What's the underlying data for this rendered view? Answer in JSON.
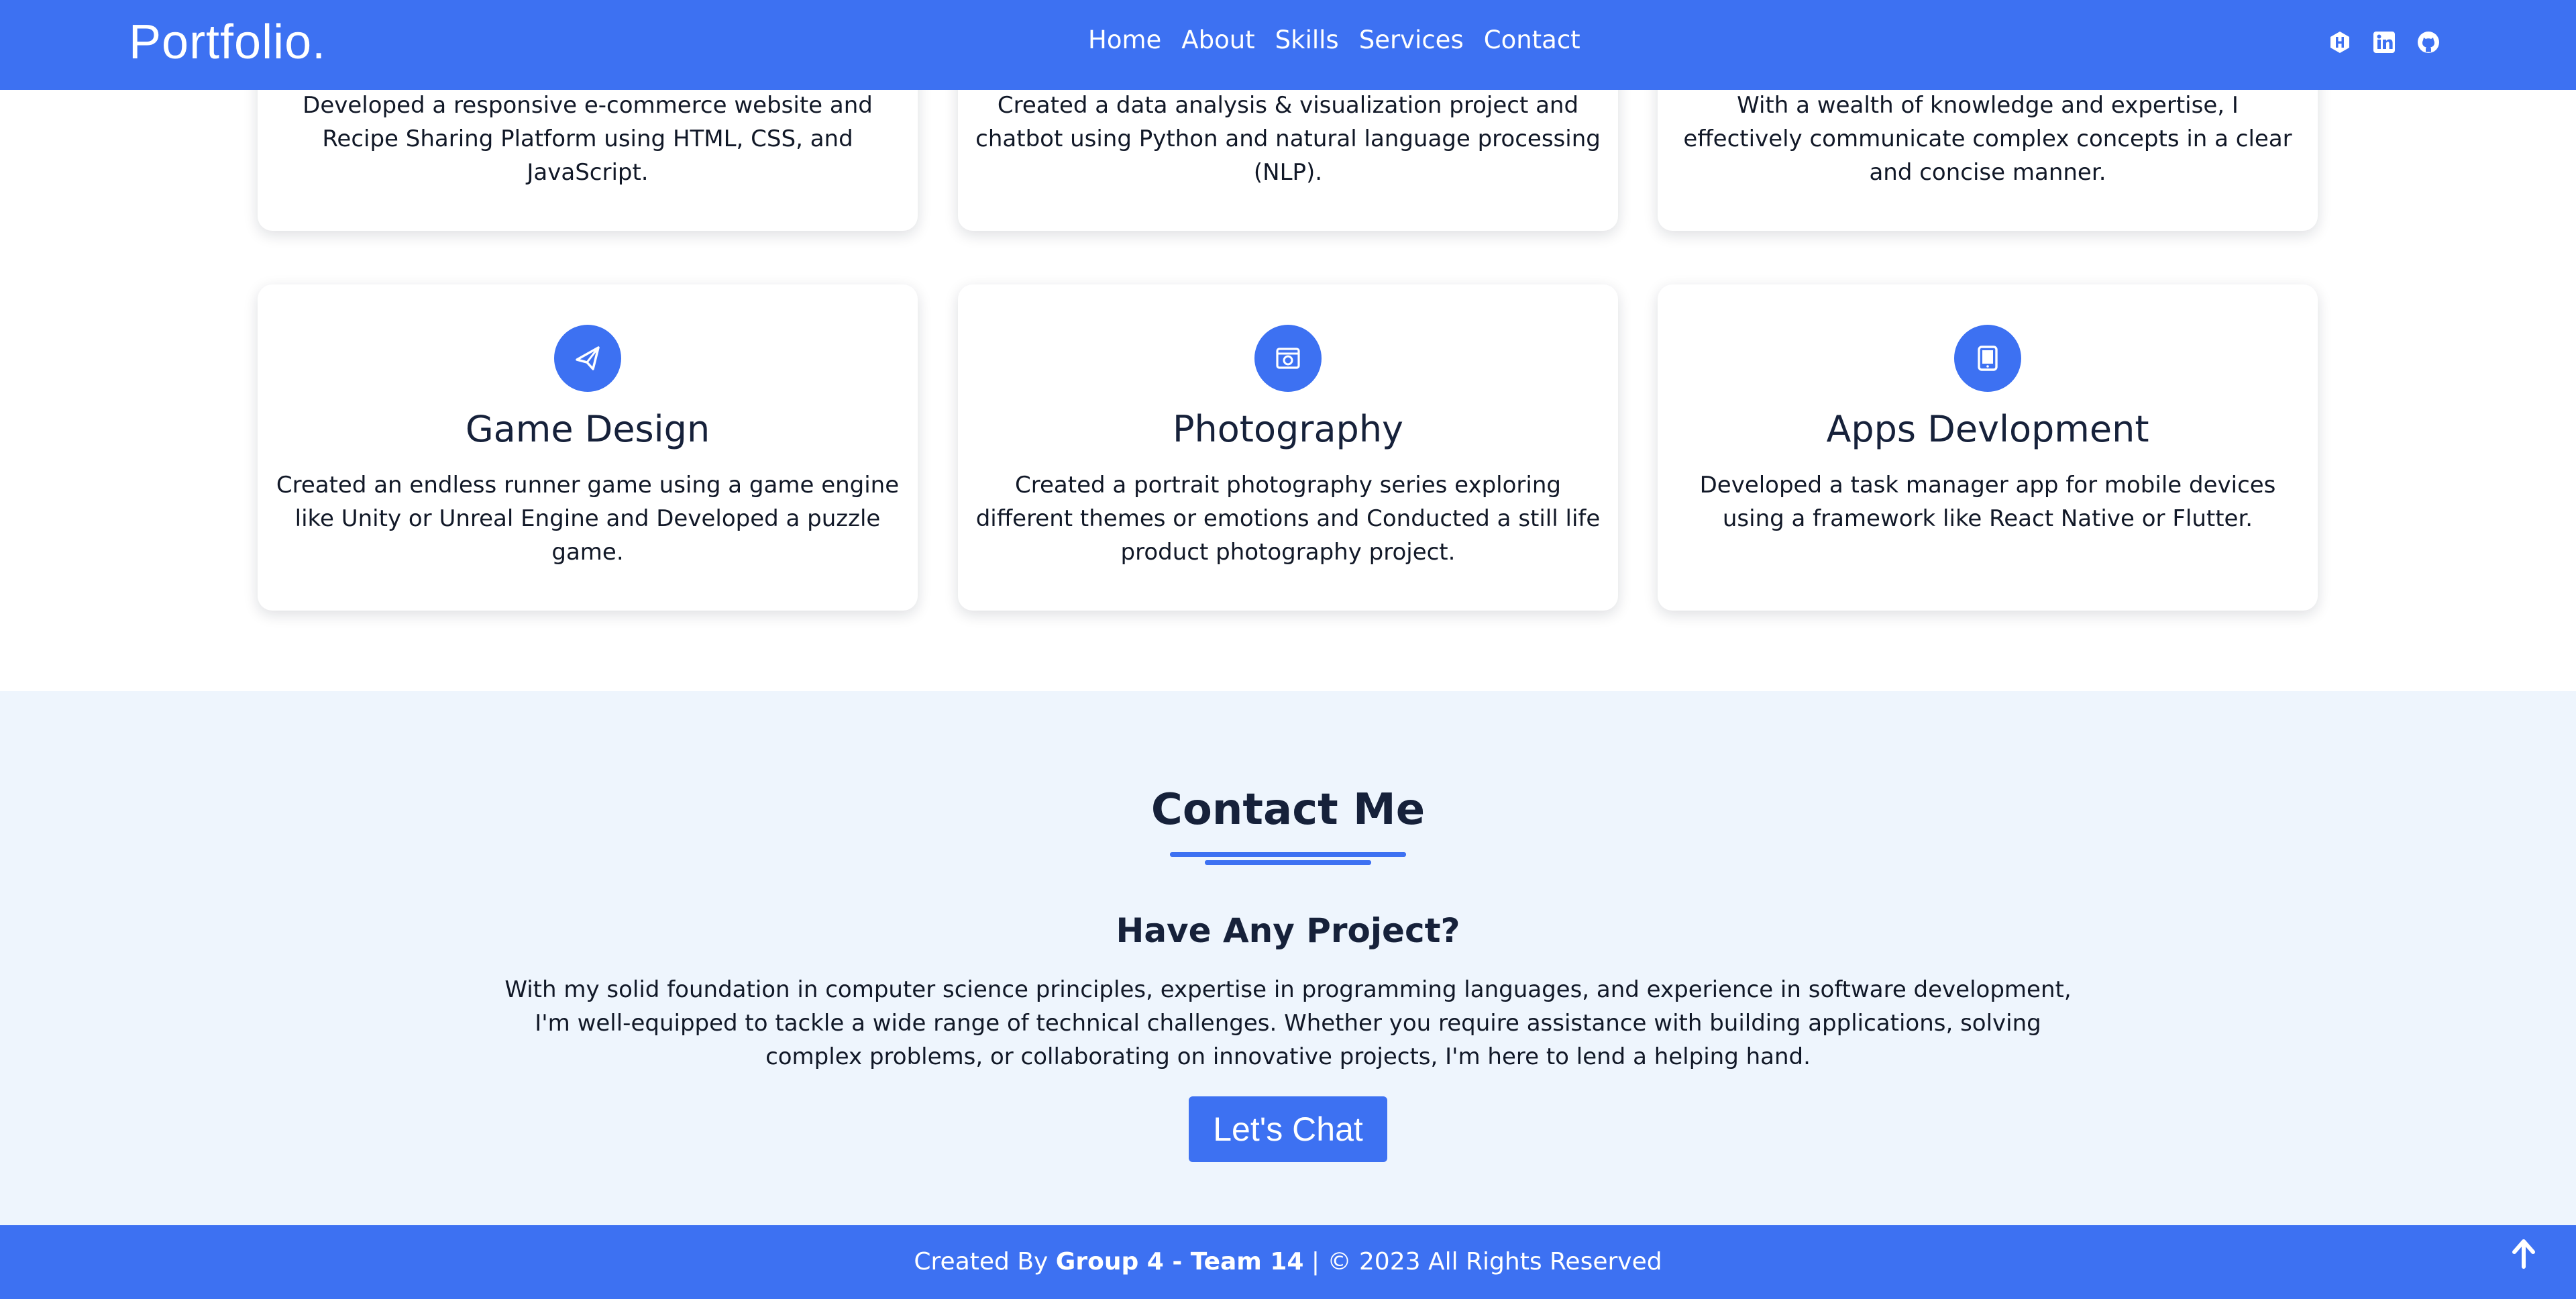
{
  "navbar": {
    "brand": "Portfolio.",
    "links": [
      "Home",
      "About",
      "Skills",
      "Services",
      "Contact"
    ],
    "social_icons": [
      "hackerrank-icon",
      "linkedin-icon",
      "github-icon"
    ]
  },
  "services": {
    "top_row": [
      {
        "description": "Developed a responsive e-commerce website and Recipe Sharing Platform using HTML, CSS, and JavaScript."
      },
      {
        "description": "Created a data analysis & visualization project and chatbot using Python and natural language processing (NLP)."
      },
      {
        "description": "With a wealth of knowledge and expertise, I effectively communicate complex concepts in a clear and concise manner."
      }
    ],
    "bottom_row": [
      {
        "icon": "paper-plane-icon",
        "title": "Game Design",
        "description": "Created an endless runner game using a game engine like Unity or Unreal Engine and Developed a puzzle game."
      },
      {
        "icon": "camera-icon",
        "title": "Photography",
        "description": "Created a portrait photography series exploring different themes or emotions and Conducted a still life product photography project."
      },
      {
        "icon": "tablet-icon",
        "title": "Apps Devlopment",
        "description": "Developed a task manager app for mobile devices using a framework like React Native or Flutter."
      }
    ]
  },
  "contact": {
    "heading": "Contact Me",
    "subheading": "Have Any Project?",
    "text": "With my solid foundation in computer science principles, expertise in programming languages, and experience in software development, I'm well-equipped to tackle a wide range of technical challenges. Whether you require assistance with building applications, solving complex problems, or collaborating on innovative projects, I'm here to lend a helping hand.",
    "button_label": "Let's Chat"
  },
  "footer": {
    "prefix": "Created By",
    "team": "Group 4 - Team 14",
    "suffix": "| © 2023 All Rights Reserved",
    "scroll_icon": "arrow-up-icon"
  },
  "colors": {
    "accent": "#3d71f2",
    "contact_bg": "#eef5fd",
    "heading": "#16213a"
  }
}
